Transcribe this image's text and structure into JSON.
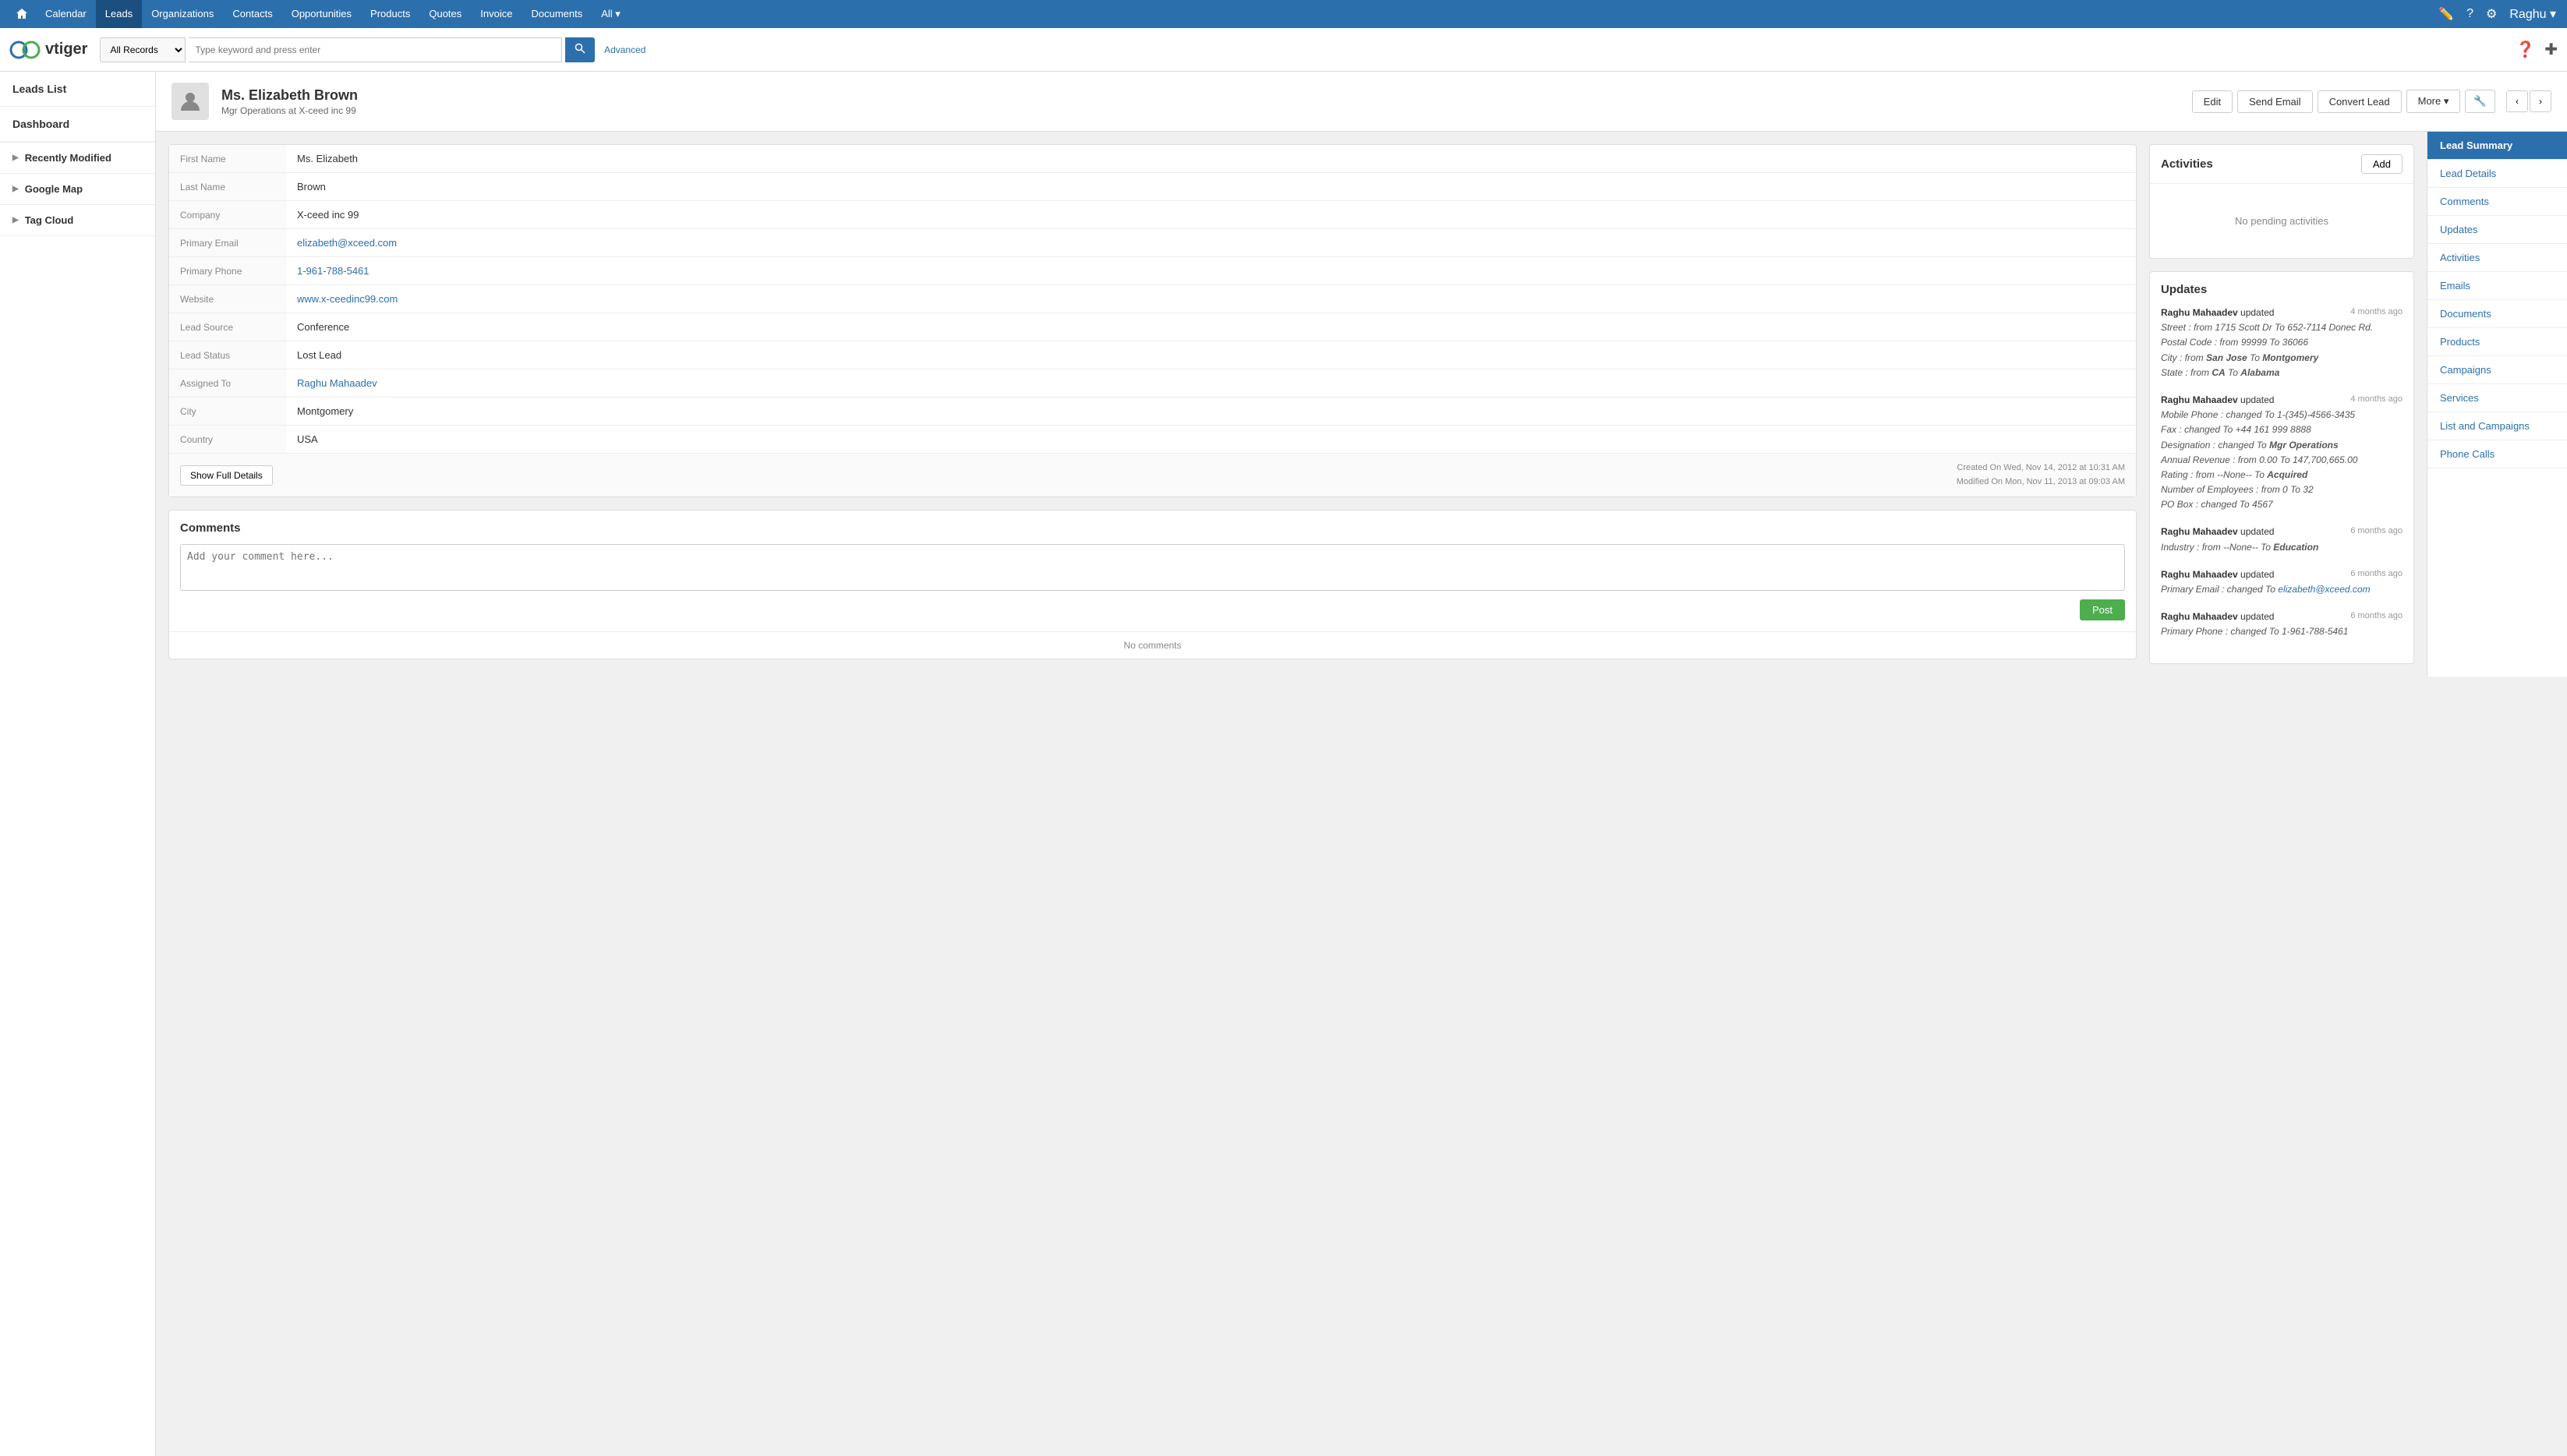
{
  "topnav": {
    "items": [
      {
        "label": "Calendar",
        "active": false
      },
      {
        "label": "Leads",
        "active": true
      },
      {
        "label": "Organizations",
        "active": false
      },
      {
        "label": "Contacts",
        "active": false
      },
      {
        "label": "Opportunities",
        "active": false
      },
      {
        "label": "Products",
        "active": false
      },
      {
        "label": "Quotes",
        "active": false
      },
      {
        "label": "Invoice",
        "active": false
      },
      {
        "label": "Documents",
        "active": false
      },
      {
        "label": "All ▾",
        "active": false
      }
    ],
    "user": "Raghu ▾"
  },
  "search": {
    "filter": "All Records",
    "placeholder": "Type keyword and press enter",
    "advanced": "Advanced"
  },
  "sidebar": {
    "leads_list": "Leads List",
    "dashboard": "Dashboard",
    "recently_modified": "Recently Modified",
    "google_map": "Google Map",
    "tag_cloud": "Tag Cloud"
  },
  "record": {
    "title": "Ms. Elizabeth Brown",
    "subtitle": "Mgr Operations at X-ceed inc 99",
    "actions": {
      "edit": "Edit",
      "send_email": "Send Email",
      "convert_lead": "Convert Lead",
      "more": "More ▾"
    }
  },
  "fields": [
    {
      "label": "First Name",
      "value": "Ms. Elizabeth",
      "type": "text"
    },
    {
      "label": "Last Name",
      "value": "Brown",
      "type": "text"
    },
    {
      "label": "Company",
      "value": "X-ceed inc 99",
      "type": "text"
    },
    {
      "label": "Primary Email",
      "value": "elizabeth@xceed.com",
      "type": "link"
    },
    {
      "label": "Primary Phone",
      "value": "1-961-788-5461",
      "type": "link"
    },
    {
      "label": "Website",
      "value": "www.x-ceedinc99.com",
      "type": "link"
    },
    {
      "label": "Lead Source",
      "value": "Conference",
      "type": "text"
    },
    {
      "label": "Lead Status",
      "value": "Lost Lead",
      "type": "text"
    },
    {
      "label": "Assigned To",
      "value": "Raghu Mahaadev",
      "type": "link"
    },
    {
      "label": "City",
      "value": "Montgomery",
      "type": "text"
    },
    {
      "label": "Country",
      "value": "USA",
      "type": "text"
    }
  ],
  "card_footer": {
    "show_full": "Show Full Details",
    "created": "Created On Wed, Nov 14, 2012 at 10:31 AM",
    "modified": "Modified On Mon, Nov 11, 2013 at 09:03 AM"
  },
  "comments": {
    "title": "Comments",
    "placeholder": "Add your comment here...",
    "post_btn": "Post",
    "no_comments": "No comments"
  },
  "activities": {
    "title": "Activities",
    "add_btn": "Add",
    "no_pending": "No pending activities"
  },
  "updates": {
    "title": "Updates",
    "items": [
      {
        "user": "Raghu Mahaadev",
        "action": "updated",
        "time": "4 months ago",
        "details": [
          "Street : from 1715 Scott Dr To 652-7114 Donec Rd.",
          "Postal Code : from 99999 To 36066",
          "City : from San Jose To Montgomery",
          "State : from CA To Alabama"
        ]
      },
      {
        "user": "Raghu Mahaadev",
        "action": "updated",
        "time": "4 months ago",
        "details": [
          "Mobile Phone : changed To 1-(345)-4566-3435",
          "Fax : changed To +44 161 999 8888",
          "Designation : changed To Mgr Operations",
          "Annual Revenue : from 0.00 To 147,700,665.00",
          "Rating : from --None-- To Acquired",
          "Number of Employees : from 0 To 32",
          "PO Box : changed To 4567"
        ]
      },
      {
        "user": "Raghu Mahaadev",
        "action": "updated",
        "time": "6 months ago",
        "details": [
          "Industry : from --None-- To Education"
        ]
      },
      {
        "user": "Raghu Mahaadev",
        "action": "updated",
        "time": "6 months ago",
        "details": [
          "Primary Email : changed To elizabeth@xceed.com"
        ],
        "email_link": "elizabeth@xceed.com"
      },
      {
        "user": "Raghu Mahaadev",
        "action": "updated",
        "time": "6 months ago",
        "details": [
          "Primary Phone : changed To 1-961-788-5461"
        ]
      }
    ]
  },
  "right_panel": {
    "items": [
      {
        "label": "Lead Summary",
        "active": true
      },
      {
        "label": "Lead Details",
        "active": false
      },
      {
        "label": "Comments",
        "active": false
      },
      {
        "label": "Updates",
        "active": false
      },
      {
        "label": "Activities",
        "active": false
      },
      {
        "label": "Emails",
        "active": false
      },
      {
        "label": "Documents",
        "active": false
      },
      {
        "label": "Products",
        "active": false
      },
      {
        "label": "Campaigns",
        "active": false
      },
      {
        "label": "Services",
        "active": false
      },
      {
        "label": "List and Campaigns",
        "active": false
      },
      {
        "label": "Phone Calls",
        "active": false
      }
    ]
  }
}
